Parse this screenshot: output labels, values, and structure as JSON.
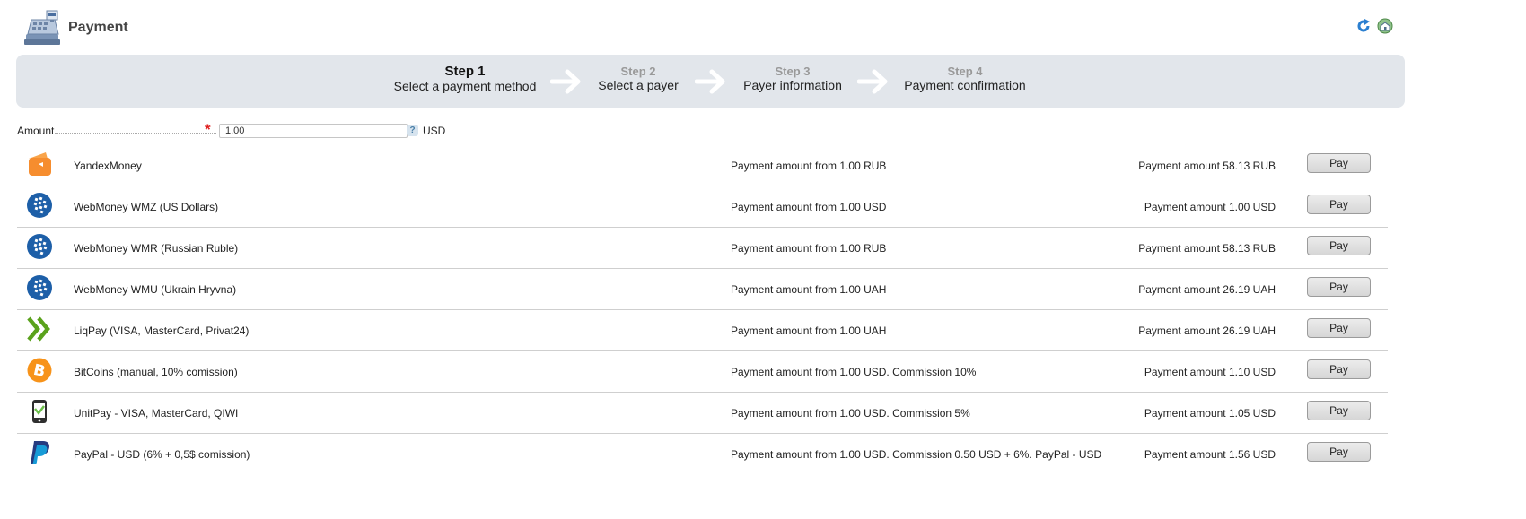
{
  "header": {
    "title": "Payment"
  },
  "steps": [
    {
      "num": "Step 1",
      "label": "Select a payment method"
    },
    {
      "num": "Step 2",
      "label": "Select a payer"
    },
    {
      "num": "Step 3",
      "label": "Payer information"
    },
    {
      "num": "Step 4",
      "label": "Payment confirmation"
    }
  ],
  "amount": {
    "label": "Amount",
    "value": "1.00",
    "required_mark": "*",
    "help": "?",
    "currency": "USD"
  },
  "methods": [
    {
      "name": "YandexMoney",
      "icon": "yandex-money-icon",
      "range": "Payment amount from 1.00 RUB",
      "amount": "Payment amount 58.13 RUB",
      "button": "Pay"
    },
    {
      "name": "WebMoney WMZ (US Dollars)",
      "icon": "webmoney-icon",
      "range": "Payment amount from 1.00 USD",
      "amount": "Payment amount 1.00 USD",
      "button": "Pay"
    },
    {
      "name": "WebMoney WMR (Russian Ruble)",
      "icon": "webmoney-icon",
      "range": "Payment amount from 1.00 RUB",
      "amount": "Payment amount 58.13 RUB",
      "button": "Pay"
    },
    {
      "name": "WebMoney WMU (Ukrain Hryvna)",
      "icon": "webmoney-icon",
      "range": "Payment amount from 1.00 UAH",
      "amount": "Payment amount 26.19 UAH",
      "button": "Pay"
    },
    {
      "name": "LiqPay (VISA, MasterCard, Privat24)",
      "icon": "liqpay-icon",
      "range": "Payment amount from 1.00 UAH",
      "amount": "Payment amount 26.19 UAH",
      "button": "Pay"
    },
    {
      "name": "BitCoins (manual, 10% comission)",
      "icon": "bitcoin-icon",
      "range": "Payment amount from 1.00 USD. Commission 10%",
      "amount": "Payment amount 1.10 USD",
      "button": "Pay"
    },
    {
      "name": "UnitPay - VISA, MasterCard, QIWI",
      "icon": "unitpay-icon",
      "range": "Payment amount from 1.00 USD. Commission 5%",
      "amount": "Payment amount 1.05 USD",
      "button": "Pay"
    },
    {
      "name": "PayPal - USD (6% + 0,5$ comission)",
      "icon": "paypal-icon",
      "range": "Payment amount from 1.00 USD. Commission 0.50 USD + 6%. PayPal - USD",
      "amount": "Payment amount 1.56 USD",
      "button": "Pay"
    }
  ]
}
